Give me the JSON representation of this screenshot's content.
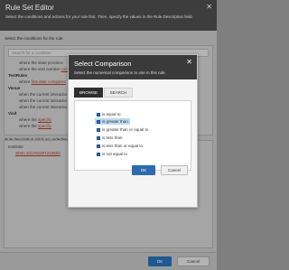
{
  "editor": {
    "title": "Rule Set Editor",
    "close_glyph": "✕",
    "description": "Select the conditions and actions for your rule first. Then, specify the values in the Rule Description field.",
    "conditions_title": "Select the conditions for the rule:",
    "search_placeholder": "Search for a condition",
    "conditions": [
      {
        "text": "where the state province",
        "link": "",
        "kind": "sub"
      },
      {
        "text": "where the visit number",
        "link": "compares",
        "kind": "sub"
      },
      {
        "text": "TestRules",
        "link": "",
        "kind": "group"
      },
      {
        "text": "where ",
        "link": "first date compares",
        "kind": "sub"
      },
      {
        "text": "Venue",
        "link": "",
        "kind": "group"
      },
      {
        "text": "when the current interactio",
        "link": "",
        "kind": "sub"
      },
      {
        "text": "when the current interactio",
        "link": "",
        "kind": "sub"
      },
      {
        "text": "when the current interactio",
        "link": "",
        "kind": "sub"
      },
      {
        "text": "Visit",
        "link": "",
        "kind": "group"
      },
      {
        "text": "where the ",
        "link": "specific",
        "kind": "sub"
      },
      {
        "text": "where the ",
        "link": "specific",
        "kind": "sub"
      }
    ],
    "description_title": "Rule description (click an underlined",
    "rule_name": "testDate",
    "rule_where": "when 20170228T215500",
    "ok_label": "OK",
    "cancel_label": "Cancel"
  },
  "modal": {
    "title": "Select Comparison",
    "close_glyph": "✕",
    "subtitle": "Select the numerical comparison to use in this rule.",
    "tabs": [
      {
        "label": "BROWSE",
        "active": true
      },
      {
        "label": "SEARCH",
        "active": false
      }
    ],
    "operators": [
      {
        "label": "is equal to",
        "selected": false
      },
      {
        "label": "is greater than",
        "selected": true
      },
      {
        "label": "is greater than or equal to",
        "selected": false
      },
      {
        "label": "is less than",
        "selected": false
      },
      {
        "label": "is less than or equal to",
        "selected": false
      },
      {
        "label": "is not equal to",
        "selected": false
      }
    ],
    "ok_label": "OK",
    "cancel_label": "Cancel"
  },
  "colors": {
    "header_dark": "#3a3a3a",
    "primary_button": "#2b6cb0",
    "selected_row": "#bcd9f2",
    "link": "#8b2f1e"
  }
}
